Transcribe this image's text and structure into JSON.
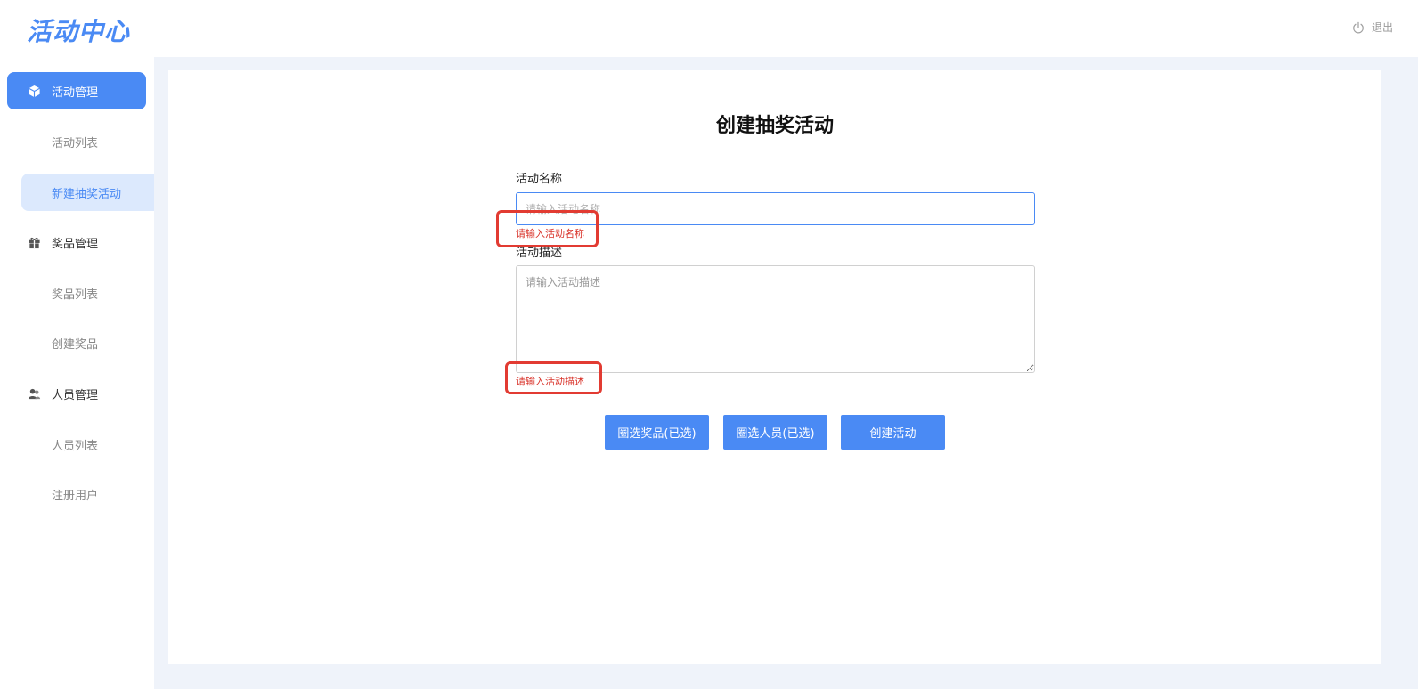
{
  "app": {
    "logo_text": "活动中心",
    "logout_label": "退出"
  },
  "sidebar": {
    "groups": [
      {
        "label": "活动管理",
        "icon": "cube-icon",
        "active": true,
        "items": [
          {
            "label": "活动列表",
            "active": false
          },
          {
            "label": "新建抽奖活动",
            "active": true
          }
        ]
      },
      {
        "label": "奖品管理",
        "icon": "gift-icon",
        "active": false,
        "items": [
          {
            "label": "奖品列表",
            "active": false
          },
          {
            "label": "创建奖品",
            "active": false
          }
        ]
      },
      {
        "label": "人员管理",
        "icon": "users-icon",
        "active": false,
        "items": [
          {
            "label": "人员列表",
            "active": false
          },
          {
            "label": "注册用户",
            "active": false
          }
        ]
      }
    ]
  },
  "form": {
    "title": "创建抽奖活动",
    "name_label": "活动名称",
    "name_placeholder": "请输入活动名称",
    "name_error": "请输入活动名称",
    "desc_label": "活动描述",
    "desc_placeholder": "请输入活动描述",
    "desc_error": "请输入活动描述",
    "buttons": {
      "select_prizes": "圈选奖品(已选)",
      "select_people": "圈选人员(已选)",
      "create": "创建活动"
    }
  },
  "colors": {
    "accent": "#4a8af4",
    "error": "#d9342b",
    "highlight": "#e23b32",
    "content_bg": "#eff3fa"
  }
}
